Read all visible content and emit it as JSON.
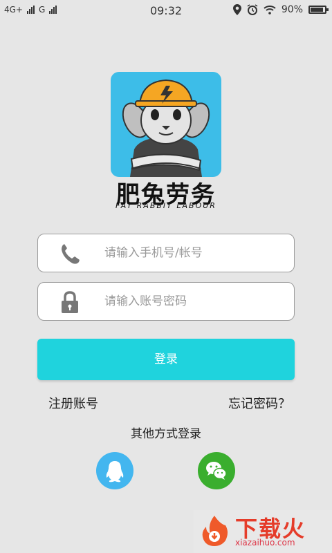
{
  "statusbar": {
    "network1": "4G+",
    "network2": "G",
    "time": "09:32",
    "battery": "90%",
    "battery_level": 0.9
  },
  "brand": {
    "name_cn": "肥兔劳务",
    "name_en": "FAT RABBIT LABOUR"
  },
  "form": {
    "phone_placeholder": "请输入手机号/帐号",
    "password_placeholder": "请输入账号密码",
    "login_label": "登录"
  },
  "links": {
    "register": "注册账号",
    "forgot": "忘记密码？"
  },
  "other_login": {
    "title": "其他方式登录",
    "methods": [
      "qq-icon",
      "wechat-icon"
    ]
  },
  "watermark": {
    "name": "下载火",
    "url": "xiazaihuo.com"
  },
  "colors": {
    "accent": "#1fd3dd",
    "logo_bg": "#3dbde8",
    "qq": "#43b6ef",
    "wechat": "#3aae2e"
  }
}
